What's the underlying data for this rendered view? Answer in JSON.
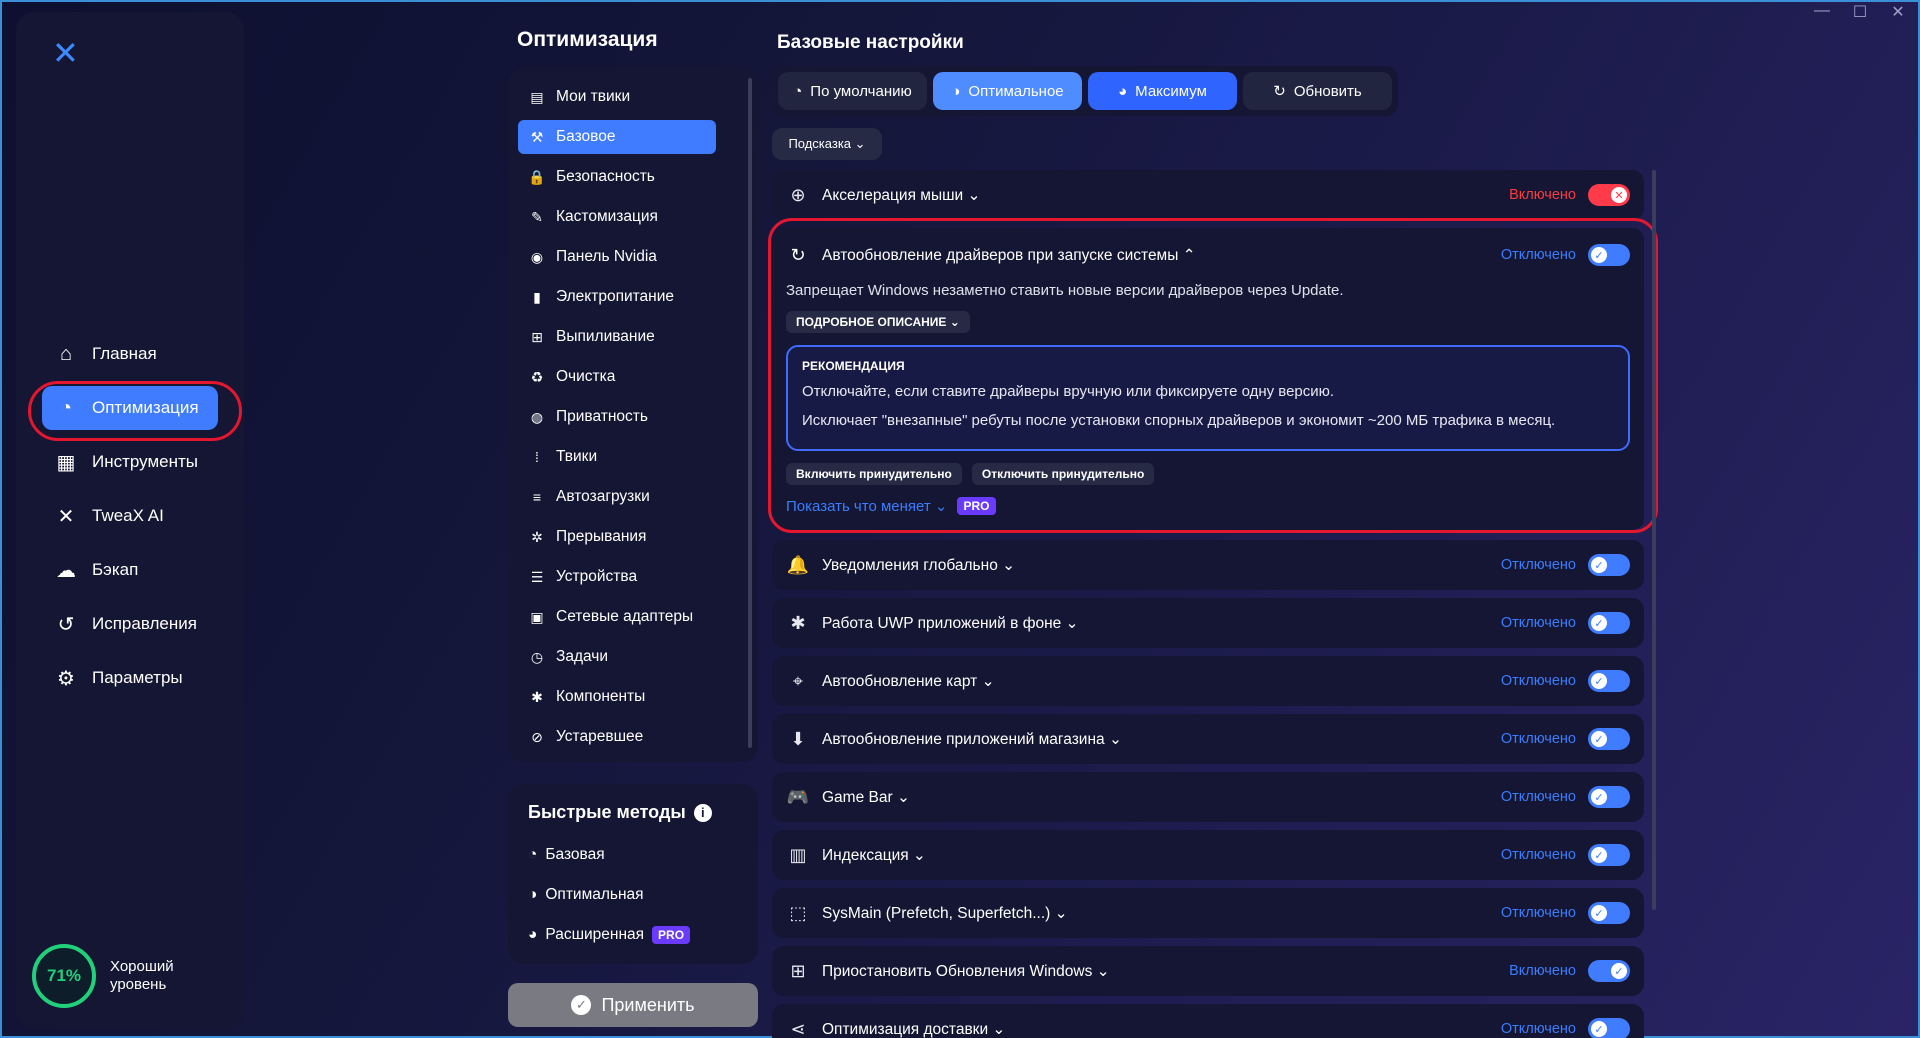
{
  "window": {
    "controls": [
      "—",
      "☐",
      "✕"
    ]
  },
  "sidebar": {
    "logo": "✕",
    "items": [
      {
        "label": "Главная",
        "icon": "home-icon",
        "glyph": "⌂"
      },
      {
        "label": "Оптимизация",
        "icon": "gauge-icon",
        "glyph": "◔",
        "active": true
      },
      {
        "label": "Инструменты",
        "icon": "grid-icon",
        "glyph": "▦"
      },
      {
        "label": "TweaX AI",
        "icon": "ai-icon",
        "glyph": "✕"
      },
      {
        "label": "Бэкап",
        "icon": "cloud-upload-icon",
        "glyph": "☁"
      },
      {
        "label": "Исправления",
        "icon": "history-icon",
        "glyph": "↺"
      },
      {
        "label": "Параметры",
        "icon": "gear-icon",
        "glyph": "⚙"
      }
    ],
    "level": {
      "percent": "71%",
      "label": "Хороший уровень",
      "value": 0.71
    }
  },
  "categories": {
    "title": "Оптимизация",
    "items": [
      {
        "label": "Мои твики",
        "icon": "my-tweaks-icon",
        "glyph": "▤"
      },
      {
        "label": "Базовое",
        "icon": "wrench-icon",
        "glyph": "⚒",
        "active": true
      },
      {
        "label": "Безопасность",
        "icon": "lock-icon",
        "glyph": "🔒"
      },
      {
        "label": "Кастомизация",
        "icon": "brush-icon",
        "glyph": "✎"
      },
      {
        "label": "Панель Nvidia",
        "icon": "nvidia-icon",
        "glyph": "◉"
      },
      {
        "label": "Электропитание",
        "icon": "battery-icon",
        "glyph": "▮"
      },
      {
        "label": "Выпиливание",
        "icon": "windows-icon",
        "glyph": "⊞"
      },
      {
        "label": "Очистка",
        "icon": "broom-icon",
        "glyph": "♻"
      },
      {
        "label": "Приватность",
        "icon": "privacy-icon",
        "glyph": "◍"
      },
      {
        "label": "Твики",
        "icon": "tweaks-grid-icon",
        "glyph": "⁞"
      },
      {
        "label": "Автозагрузки",
        "icon": "startup-icon",
        "glyph": "≡"
      },
      {
        "label": "Прерывания",
        "icon": "interrupt-icon",
        "glyph": "✲"
      },
      {
        "label": "Устройства",
        "icon": "devices-icon",
        "glyph": "☰"
      },
      {
        "label": "Сетевые адаптеры",
        "icon": "network-icon",
        "glyph": "▣"
      },
      {
        "label": "Задачи",
        "icon": "tasks-icon",
        "glyph": "◷"
      },
      {
        "label": "Компоненты",
        "icon": "components-icon",
        "glyph": "✱"
      },
      {
        "label": "Устаревшее",
        "icon": "deprecated-icon",
        "glyph": "⊘"
      }
    ]
  },
  "quick": {
    "title": "Быстрые методы",
    "items": [
      {
        "label": "Базовая",
        "icon": "gauge-low-icon",
        "glyph": "◔"
      },
      {
        "label": "Оптимальная",
        "icon": "gauge-mid-icon",
        "glyph": "◑"
      },
      {
        "label": "Расширенная",
        "icon": "gauge-high-icon",
        "glyph": "◕",
        "pro": "PRO"
      }
    ],
    "apply": "Применить"
  },
  "main": {
    "title": "Базовые настройки",
    "presets": [
      {
        "label": "По умолчанию",
        "glyph": "◔"
      },
      {
        "label": "Оптимальное",
        "glyph": "◑"
      },
      {
        "label": "Максимум",
        "glyph": "◕"
      },
      {
        "label": "Обновить",
        "glyph": "↻"
      }
    ],
    "hint": "Подсказка ⌄",
    "rows_top": [
      {
        "label": "Акселерация мыши ⌄",
        "status": "Включено",
        "state": "red",
        "icon": "mouse-icon",
        "glyph": "⊕"
      }
    ],
    "expanded": {
      "label": "Автообновление драйверов при запуске системы ⌃",
      "status": "Отключено",
      "icon": "refresh-icon",
      "glyph": "↻",
      "desc": "Запрещает Windows незаметно ставить новые версии драйверов через Update.",
      "detail": "ПОДРОБНОЕ ОПИСАНИЕ ⌄",
      "reco_title": "РЕКОМЕНДАЦИЯ",
      "reco_1": "Отключайте, если ставите драйверы вручную или фиксируете одну версию.",
      "reco_2": "Исключает \"внезапные\" ребуты после установки спорных драйверов и экономит ~200 МБ трафика в месяц.",
      "force_on": "Включить принудительно",
      "force_off": "Отключить принудительно",
      "show": "Показать что меняет ⌄",
      "pro": "PRO"
    },
    "rows": [
      {
        "label": "Уведомления глобально ⌄",
        "status": "Отключено",
        "state": "off",
        "icon": "bell-icon",
        "glyph": "🔔"
      },
      {
        "label": "Работа UWP приложений в фоне ⌄",
        "status": "Отключено",
        "state": "off",
        "icon": "puzzle-icon",
        "glyph": "✱"
      },
      {
        "label": "Автообновление карт ⌄",
        "status": "Отключено",
        "state": "off",
        "icon": "map-icon",
        "glyph": "⌖"
      },
      {
        "label": "Автообновление приложений магазина ⌄",
        "status": "Отключено",
        "state": "off",
        "icon": "download-icon",
        "glyph": "⬇"
      },
      {
        "label": "Game Bar ⌄",
        "status": "Отключено",
        "state": "off",
        "icon": "gamepad-icon",
        "glyph": "🎮"
      },
      {
        "label": "Индексация ⌄",
        "status": "Отключено",
        "state": "off",
        "icon": "index-icon",
        "glyph": "▥"
      },
      {
        "label": "SysMain (Prefetch, Superfetch...) ⌄",
        "status": "Отключено",
        "state": "off",
        "icon": "sysmain-icon",
        "glyph": "⬚"
      },
      {
        "label": "Приостановить Обновления Windows ⌄",
        "status": "Включено",
        "state": "on",
        "icon": "windows-icon",
        "glyph": "⊞"
      },
      {
        "label": "Оптимизация доставки ⌄",
        "status": "Отключено",
        "state": "off",
        "icon": "share-icon",
        "glyph": "⋖"
      }
    ]
  }
}
